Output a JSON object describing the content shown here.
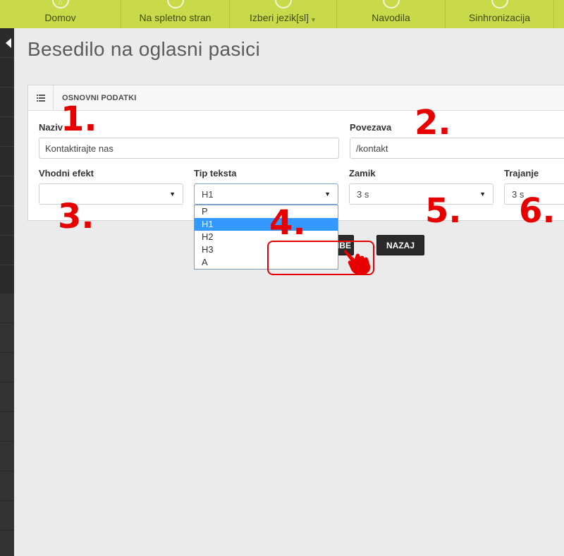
{
  "nav": {
    "items": [
      {
        "label": "Domov",
        "icon": "home-icon"
      },
      {
        "label": "Na spletno stran",
        "icon": "globe-icon"
      },
      {
        "label": "Izberi jezik[sl]",
        "icon": "language-icon",
        "has_caret": true
      },
      {
        "label": "Navodila",
        "icon": "book-icon"
      },
      {
        "label": "Sinhronizacija",
        "icon": "sync-icon"
      }
    ]
  },
  "page": {
    "title": "Besedilo na oglasni pasici"
  },
  "panel": {
    "title": "OSNOVNI PODATKI",
    "fields": {
      "naziv": {
        "label": "Naziv",
        "value": "Kontaktirajte nas"
      },
      "povezava": {
        "label": "Povezava",
        "value": "/kontakt"
      },
      "vhodni_efekt": {
        "label": "Vhodni efekt",
        "value": ""
      },
      "tip_teksta": {
        "label": "Tip teksta",
        "value": "H1",
        "options": [
          "P",
          "H1",
          "H2",
          "H3",
          "A"
        ],
        "selected_index": 1
      },
      "zamik": {
        "label": "Zamik",
        "value": "3 s"
      },
      "trajanje": {
        "label": "Trajanje",
        "value": "3 s"
      }
    }
  },
  "buttons": {
    "save_partial": "EMBE",
    "back": "NAZAJ"
  },
  "annotations": [
    "1.",
    "2.",
    "3.",
    "4.",
    "5.",
    "6."
  ],
  "colors": {
    "nav_bg": "#c8d94a",
    "annotation": "#e60000",
    "selected_option": "#3399ff",
    "button_bg": "#2a2a2a"
  }
}
